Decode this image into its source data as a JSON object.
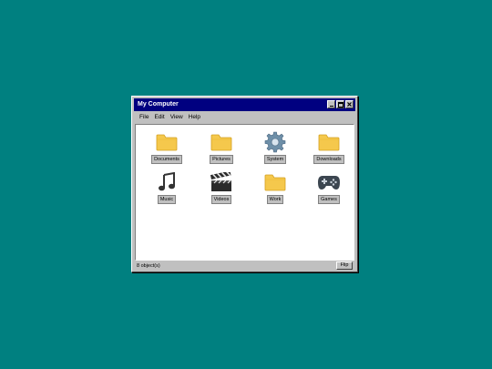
{
  "window": {
    "title": "My Computer"
  },
  "menu": {
    "items": [
      "File",
      "Edit",
      "View",
      "Help"
    ]
  },
  "icons": [
    {
      "label": "Documents",
      "type": "folder"
    },
    {
      "label": "Pictures",
      "type": "folder"
    },
    {
      "label": "System",
      "type": "gear"
    },
    {
      "label": "Downloads",
      "type": "folder"
    },
    {
      "label": "Music",
      "type": "music"
    },
    {
      "label": "Videos",
      "type": "clapper"
    },
    {
      "label": "Work",
      "type": "folder"
    },
    {
      "label": "Games",
      "type": "gamepad"
    }
  ],
  "status": {
    "text": "8 object(s)",
    "flip_label": "Flip"
  },
  "colors": {
    "desktop": "#008080",
    "titlebar": "#000080",
    "folder": "#f5c84c"
  }
}
